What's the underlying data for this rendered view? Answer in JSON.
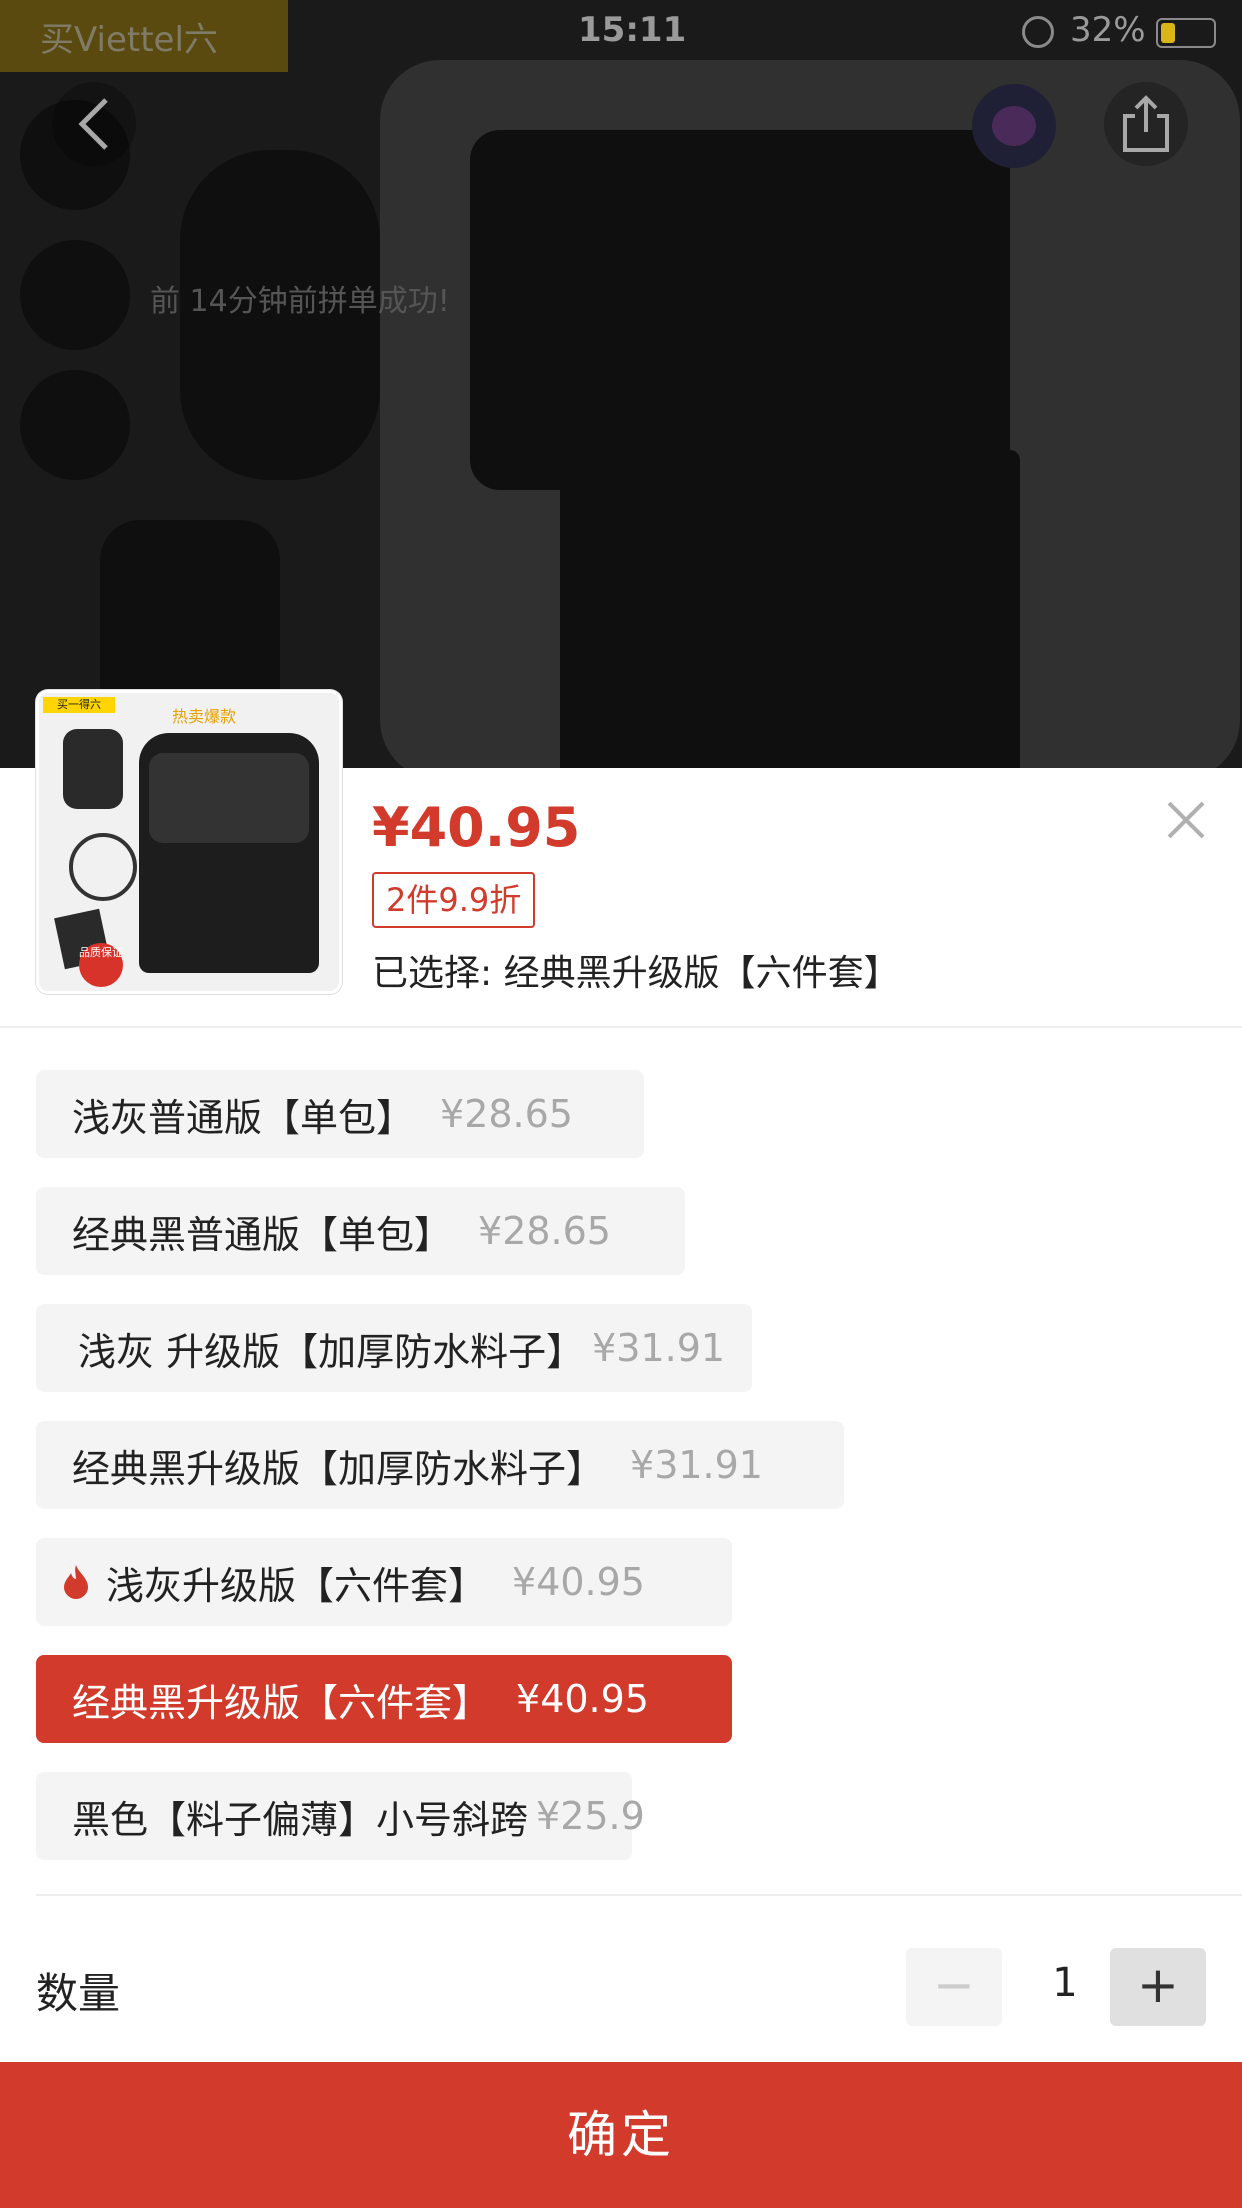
{
  "status_bar": {
    "carrier": "买Viettel六",
    "time": "15:11",
    "battery": "32%"
  },
  "background": {
    "toast": "前 14分钟前拼单成功!"
  },
  "sheet": {
    "price": "¥40.95",
    "promo": "2件9.9折",
    "selected_text": "已选择: 经典黑升级版【六件套】",
    "thumbnail": {
      "banner": "买一得六",
      "hot": "热卖爆款",
      "stamp": "品质保证"
    },
    "options": [
      {
        "label": "浅灰普通版【单包】",
        "price": "¥28.65",
        "hot": false,
        "selected": false
      },
      {
        "label": "经典黑普通版【单包】",
        "price": "¥28.65",
        "hot": false,
        "selected": false
      },
      {
        "label": "浅灰 升级版【加厚防水料子】",
        "price": "¥31.91",
        "hot": true,
        "selected": false
      },
      {
        "label": "经典黑升级版【加厚防水料子】",
        "price": "¥31.91",
        "hot": false,
        "selected": false
      },
      {
        "label": "浅灰升级版【六件套】",
        "price": "¥40.95",
        "hot": true,
        "selected": false
      },
      {
        "label": "经典黑升级版【六件套】",
        "price": "¥40.95",
        "hot": false,
        "selected": true
      },
      {
        "label": "黑色【料子偏薄】小号斜跨",
        "price": "¥25.9",
        "hot": false,
        "selected": false
      }
    ],
    "quantity_label": "数量",
    "quantity": "1",
    "minus": "−",
    "plus": "+",
    "confirm": "确定"
  },
  "colors": {
    "accent": "#d23b2c",
    "option_bg": "#f4f4f4"
  }
}
